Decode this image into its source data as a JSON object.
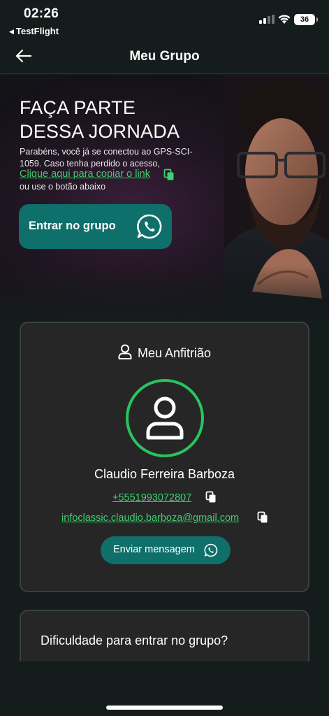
{
  "status_bar": {
    "time": "02:26",
    "back_app": "TestFlight",
    "battery": "36"
  },
  "header": {
    "title": "Meu Grupo"
  },
  "hero": {
    "title_line1": "FAÇA PARTE",
    "title_line2": "DESSA JORNADA",
    "text": "Parabéns, você já se conectou ao GPS-SCI-1059. Caso tenha perdido o acesso,",
    "copy_link": "Clique aqui para copiar o link",
    "sub_text": "ou use o botão abaixo",
    "join_button": "Entrar no grupo"
  },
  "host": {
    "header": "Meu Anfitrião",
    "name": "Claudio Ferreira Barboza",
    "phone": "+5551993072807",
    "email": "infoclassic.claudio.barboza@gmail.com",
    "message_button": "Enviar mensagem"
  },
  "help": {
    "title": "Dificuldade para entrar no grupo?"
  },
  "colors": {
    "accent_green": "#3ecf6e",
    "button_teal": "#0e6f6b",
    "avatar_ring": "#29c45f",
    "background": "#151c1c",
    "card": "#262626"
  },
  "icons": [
    "back-arrow-icon",
    "copy-icon",
    "whatsapp-icon",
    "user-icon",
    "wifi-icon",
    "signal-icon",
    "battery-icon"
  ]
}
